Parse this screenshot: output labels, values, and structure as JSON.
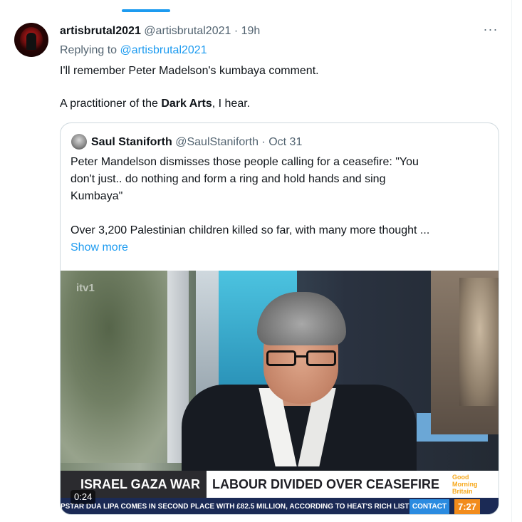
{
  "tweet": {
    "author_name": "artisbrutal2021",
    "author_handle": "@artisbrutal2021",
    "separator": "·",
    "time": "19h",
    "replying_prefix": "Replying to",
    "replying_to": "@artisbrutal2021",
    "line1": "I'll remember Peter Madelson's kumbaya comment.",
    "line2_before": "A practitioner of the ",
    "line2_bold": "Dark Arts",
    "line2_after": ", I hear.",
    "more_glyph": "···"
  },
  "quote": {
    "author_name": "Saul Staniforth",
    "author_handle": "@SaulStaniforth",
    "separator": "·",
    "date": "Oct 31",
    "line1": "Peter Mandelson dismisses those people calling for a ceasefire: \"You",
    "line2": "don't just.. do nothing and form a ring and hold hands and sing",
    "line3": "Kumbaya\"",
    "line4": "Over 3,200 Palestinian children killed so far, with many more thought ...",
    "show_more": "Show more"
  },
  "video": {
    "channel_logo": "itv1",
    "headline_left": "ISRAEL GAZA WAR",
    "headline_right": "LABOUR DIVIDED OVER CEASEFIRE",
    "show_logo_line1": "Good",
    "show_logo_line2": "Morning",
    "show_logo_line3": "Britain",
    "ticker": "PSTAR DUA LIPA COMES IN SECOND PLACE WITH £82.5 MILLION, ACCORDING TO HEAT'S RICH LIST",
    "ticker_contact": "CONTACT",
    "clock": "7:27",
    "timestamp": "0:24"
  },
  "colors": {
    "accent": "#1d9bf0",
    "secondary_text": "#536471",
    "border": "#cfd9de"
  }
}
